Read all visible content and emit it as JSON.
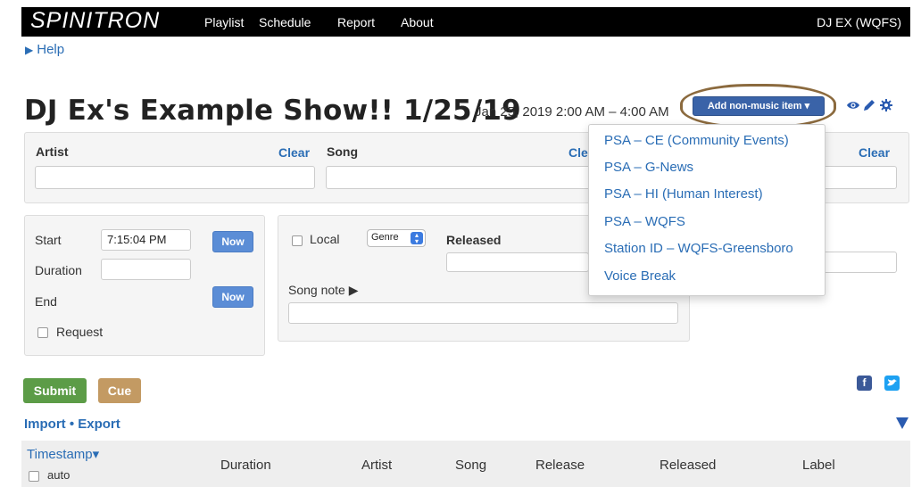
{
  "navbar": {
    "brand": "SPINITRON",
    "links": [
      "Playlist",
      "Schedule",
      "Report",
      "About"
    ],
    "user": "DJ EX (WQFS)"
  },
  "help": {
    "label": "Help"
  },
  "header": {
    "title": "DJ Ex's Example Show!! 1/25/19",
    "date_range": "Jan 25, 2019 2:00 AM – 4:00 AM",
    "nonmusic_button": "Add non-music item ▾"
  },
  "entry_row": {
    "artist_label": "Artist",
    "song_label": "Song",
    "clear_label": "Clear",
    "clear_partial": "Cle"
  },
  "timing": {
    "start_label": "Start",
    "start_value": "7:15:04 PM",
    "duration_label": "Duration",
    "end_label": "End",
    "now_label": "Now",
    "request_label": "Request"
  },
  "details": {
    "local_label": "Local",
    "genre_value": "Genre",
    "released_label": "Released",
    "song_note_label": "Song note ▶"
  },
  "dropdown": {
    "items": [
      "PSA – CE (Community Events)",
      "PSA – G-News",
      "PSA – HI (Human Interest)",
      "PSA – WQFS",
      "Station ID – WQFS-Greensboro",
      "Voice Break"
    ]
  },
  "actions": {
    "submit": "Submit",
    "cue": "Cue",
    "import_export": "Import • Export"
  },
  "table": {
    "timestamp": "Timestamp▾",
    "auto": "auto",
    "columns": [
      "Duration",
      "Artist",
      "Song",
      "Release",
      "Released",
      "Label"
    ]
  },
  "colors": {
    "navbar": "#000000",
    "link": "#2a6db5",
    "primary_button": "#3a63a8",
    "submit": "#5c9c47",
    "cue": "#c39a63",
    "highlight": "#8b6a3e"
  },
  "icons": [
    "eye-icon",
    "pencil-icon",
    "gear-icon",
    "facebook-icon",
    "twitter-icon",
    "collapse-triangle-icon"
  ]
}
